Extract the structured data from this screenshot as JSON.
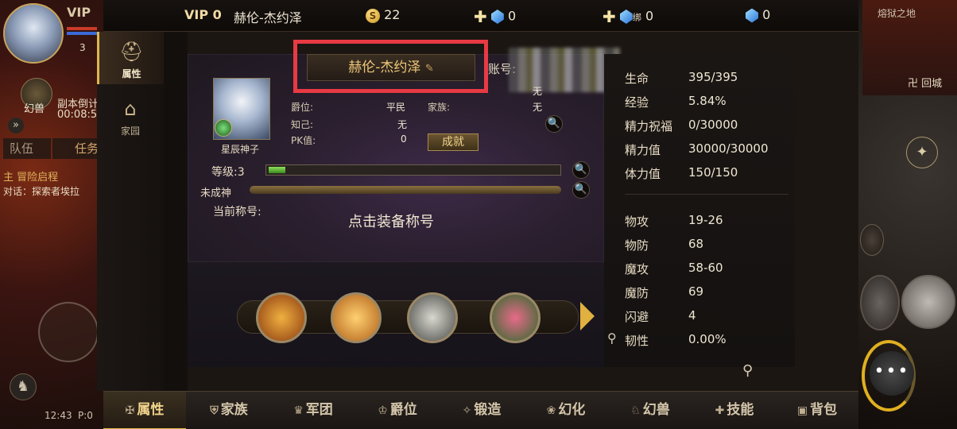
{
  "top_bar": {
    "vip": "VIP 0",
    "player_name": "赫伦-杰约泽",
    "gold_icon": "S",
    "gold": "22",
    "diamond": "0",
    "bound_diamond_tag": "绑",
    "bound_diamond": "0",
    "locked_diamond": "0"
  },
  "left_hud": {
    "vip": "VIP",
    "level": "3",
    "pet_label": "幻兽",
    "dungeon_label": "副本倒计",
    "dungeon_time": "00:08:5",
    "expand": "»",
    "tab_team": "队伍",
    "tab_task": "任务",
    "quest_title": "主 冒险启程",
    "quest_desc": "对话：探索者埃拉",
    "clock": "12:43",
    "ping": "P:0"
  },
  "right_hud": {
    "map_name": "熔狱之地",
    "back_city": "卍 回城",
    "compass": "✦",
    "chat": "•••"
  },
  "side_nav": [
    {
      "label": "属性",
      "icon": "helmet-icon"
    },
    {
      "label": "家园",
      "icon": "house-icon"
    }
  ],
  "hero": {
    "name_plate": "赫伦-杰约泽",
    "account_label": "账号:",
    "portrait_caption": "星辰神子",
    "rows": [
      {
        "key": "",
        "value": "无"
      },
      {
        "key": "爵位:",
        "value": "平民",
        "key2": "家族:",
        "value2": "无"
      },
      {
        "key": "知己:",
        "value": "无"
      },
      {
        "key": "PK值:",
        "value": "0"
      }
    ],
    "achievement_button": "成就",
    "level_label": "等级:3",
    "level_progress": 0.0584,
    "god_label": "未成神",
    "title_label": "当前称号:",
    "title_hint": "点击装备称号",
    "magnifier": "🔍"
  },
  "stats": {
    "vital": [
      {
        "key": "生命",
        "value": "395/395"
      },
      {
        "key": "经验",
        "value": "5.84%"
      },
      {
        "key": "精力祝福",
        "value": "0/30000"
      },
      {
        "key": "精力值",
        "value": "30000/30000"
      },
      {
        "key": "体力值",
        "value": "150/150"
      }
    ],
    "combat": [
      {
        "key": "物攻",
        "value": "19-26"
      },
      {
        "key": "物防",
        "value": "68"
      },
      {
        "key": "魔攻",
        "value": "58-60"
      },
      {
        "key": "魔防",
        "value": "69"
      },
      {
        "key": "闪避",
        "value": "4"
      },
      {
        "key": "韧性",
        "value": "0.00%"
      }
    ]
  },
  "bottom_tabs": [
    {
      "label": "属性",
      "icon": "✠"
    },
    {
      "label": "家族",
      "icon": "⛨"
    },
    {
      "label": "军团",
      "icon": "♛"
    },
    {
      "label": "爵位",
      "icon": "♔"
    },
    {
      "label": "锻造",
      "icon": "✧"
    },
    {
      "label": "幻化",
      "icon": "❀"
    },
    {
      "label": "幻兽",
      "icon": "♘"
    },
    {
      "label": "技能",
      "icon": "✚"
    },
    {
      "label": "背包",
      "icon": "▣"
    }
  ]
}
